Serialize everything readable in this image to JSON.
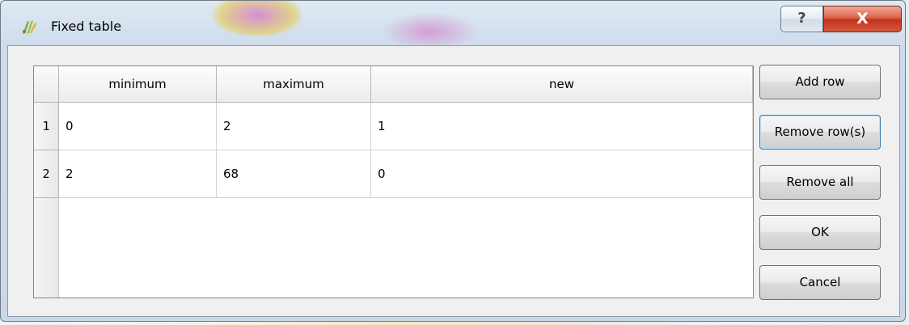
{
  "window": {
    "title": "Fixed table",
    "help_glyph": "?",
    "close_glyph": "X",
    "icon": "qgis-logo-icon"
  },
  "table": {
    "columns": [
      "minimum",
      "maximum",
      "new"
    ],
    "rows": [
      {
        "header": "1",
        "cells": [
          "0",
          "2",
          "1"
        ]
      },
      {
        "header": "2",
        "cells": [
          "2",
          "68",
          "0"
        ]
      }
    ]
  },
  "buttons": {
    "add_row": "Add row",
    "remove_rows": "Remove row(s)",
    "remove_all": "Remove all",
    "ok": "OK",
    "cancel": "Cancel"
  }
}
